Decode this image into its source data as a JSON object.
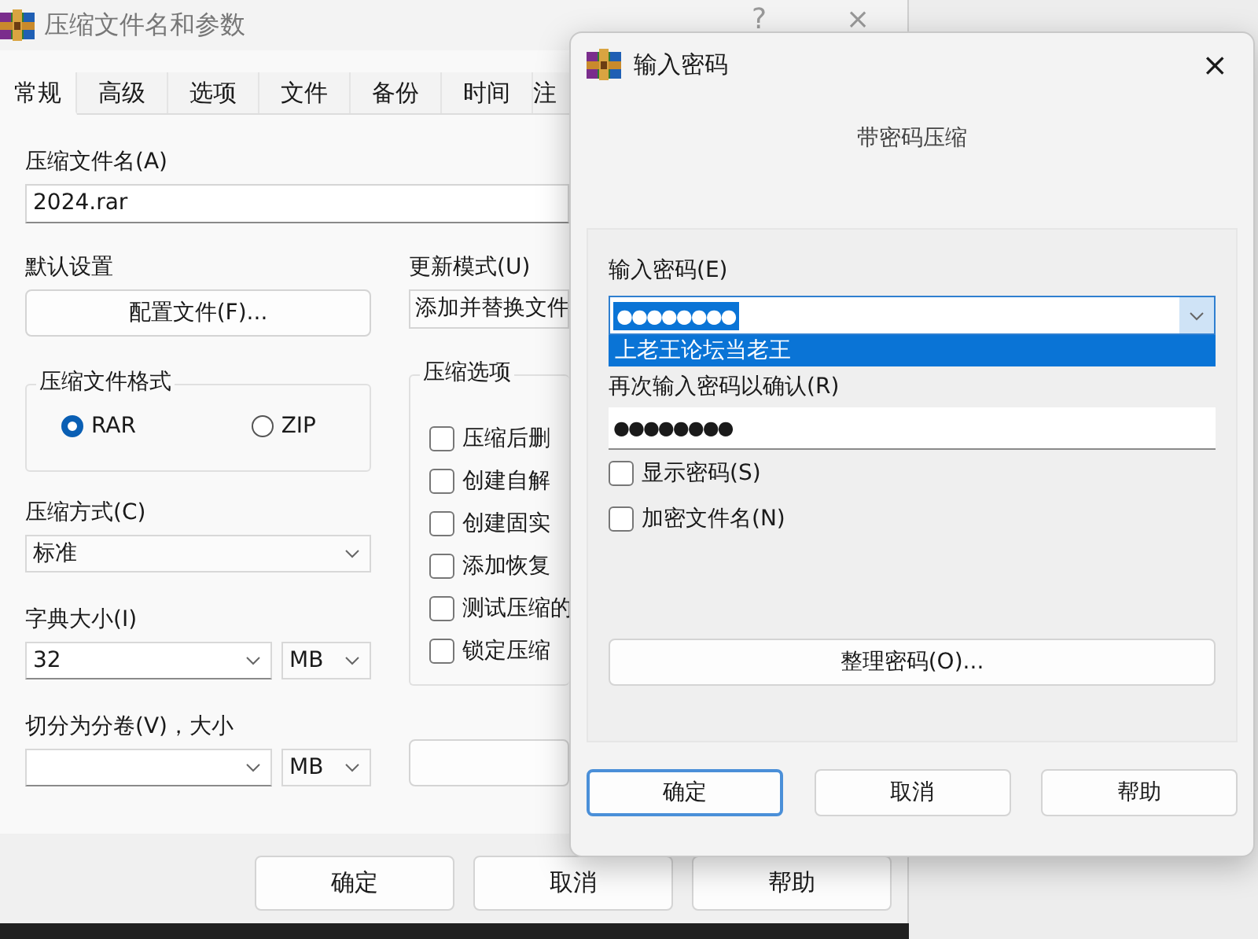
{
  "main_window": {
    "title": "压缩文件名和参数",
    "title_buttons": [
      "?",
      "×"
    ],
    "tabs": [
      {
        "label": "常规",
        "selected": true
      },
      {
        "label": "高级",
        "selected": false
      },
      {
        "label": "选项",
        "selected": false
      },
      {
        "label": "文件",
        "selected": false
      },
      {
        "label": "备份",
        "selected": false
      },
      {
        "label": "时间",
        "selected": false
      },
      {
        "label": "注",
        "selected": false
      }
    ],
    "archive_name": {
      "label": "压缩文件名(A)",
      "value": "2024.rar"
    },
    "profile": {
      "label": "默认设置",
      "button": "配置文件(F)..."
    },
    "update_mode": {
      "label": "更新模式(U)",
      "value": "添加并替换文件"
    },
    "format": {
      "label": "压缩文件格式",
      "options": [
        {
          "label": "RAR",
          "selected": true
        },
        {
          "label": "ZIP",
          "selected": false
        }
      ]
    },
    "options": {
      "label": "压缩选项",
      "items": [
        {
          "label": "压缩后删",
          "checked": false
        },
        {
          "label": "创建自解",
          "checked": false
        },
        {
          "label": "创建固实",
          "checked": false
        },
        {
          "label": "添加恢复",
          "checked": false
        },
        {
          "label": "测试压缩的",
          "checked": false
        },
        {
          "label": "锁定压缩",
          "checked": false
        }
      ]
    },
    "method": {
      "label": "压缩方式(C)",
      "value": "标准"
    },
    "dictionary": {
      "label": "字典大小(I)",
      "value": "32",
      "unit": "MB"
    },
    "volumes": {
      "label": "切分为分卷(V)，大小",
      "unit": "MB"
    },
    "buttons": [
      "确定",
      "取消",
      "帮助"
    ]
  },
  "password_dialog": {
    "title": "输入密码",
    "close": "×",
    "subtitle": "带密码压缩",
    "password": {
      "label": "输入密码(E)",
      "value": "●●●●●●●●",
      "suggestion": "上老王论坛当老王"
    },
    "confirm": {
      "label": "再次输入密码以确认(R)",
      "value": "●●●●●●●●"
    },
    "checkboxes": [
      {
        "label": "显示密码(S)",
        "checked": false
      },
      {
        "label": "加密文件名(N)",
        "checked": false
      }
    ],
    "organize_button": "整理密码(O)...",
    "buttons": [
      {
        "label": "确定",
        "selected": true
      },
      {
        "label": "取消",
        "selected": false
      },
      {
        "label": "帮助",
        "selected": false
      }
    ]
  }
}
